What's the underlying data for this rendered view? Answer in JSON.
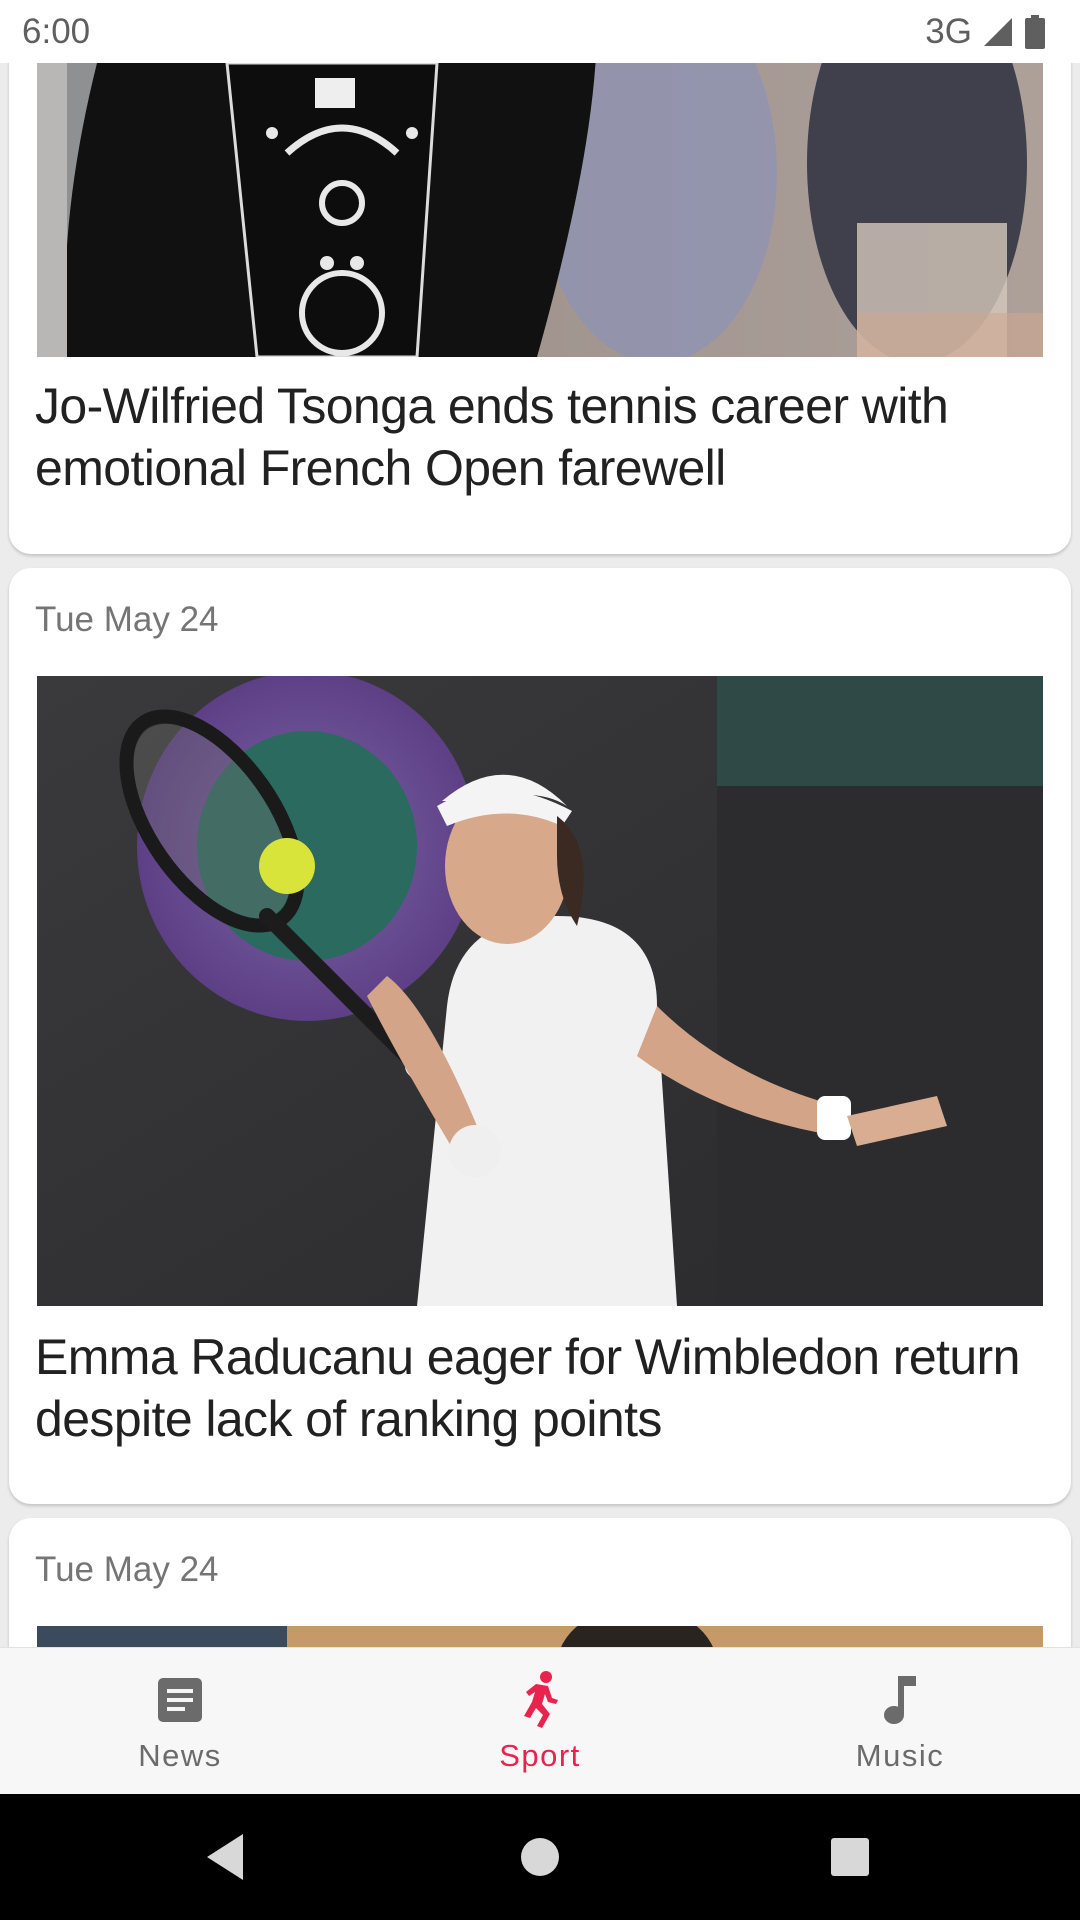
{
  "status_bar": {
    "time": "6:00",
    "network": "3G",
    "icons": [
      "signal-icon",
      "battery-icon"
    ]
  },
  "feed": {
    "articles": [
      {
        "date": "",
        "title": "Jo-Wilfried Tsonga ends tennis career with emotional French Open farewell",
        "image": "tennis-player-photo"
      },
      {
        "date": "Tue May 24",
        "title": "Emma Raducanu eager for Wimbledon return despite lack of ranking points",
        "image": "tennis-player-photo"
      },
      {
        "date": "Tue May 24",
        "title": "",
        "image": "tennis-player-photo"
      }
    ]
  },
  "bottom_nav": {
    "items": [
      {
        "label": "News",
        "icon": "news-icon",
        "active": false
      },
      {
        "label": "Sport",
        "icon": "sport-icon",
        "active": true
      },
      {
        "label": "Music",
        "icon": "music-note-icon",
        "active": false
      }
    ]
  },
  "system_nav": {
    "icons": [
      "back-icon",
      "home-icon",
      "recents-icon"
    ]
  },
  "colors": {
    "accent": "#e8234d",
    "background": "#ececec",
    "card": "#ffffff",
    "title_text": "#212121",
    "date_text": "#757575"
  }
}
